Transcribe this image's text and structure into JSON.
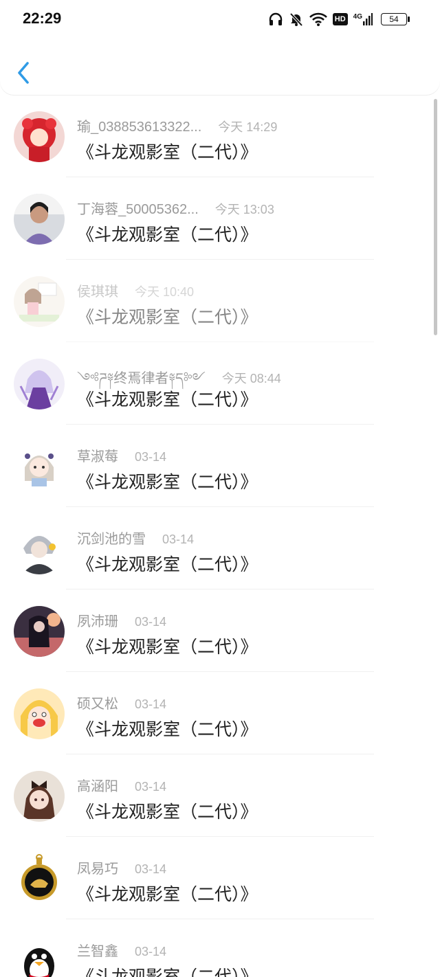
{
  "status_bar": {
    "time": "22:29",
    "battery": "54",
    "network_label": "4G",
    "hd_label": "HD"
  },
  "header": {
    "back_icon": "chevron-left-icon"
  },
  "colors": {
    "accent": "#2f9be6",
    "name_gray": "#9a9a9a",
    "time_gray": "#b3b3b3"
  },
  "messages": [
    {
      "name": "瑜_038853613322...",
      "time": "今天 14:29",
      "text": "《斗龙观影室（二代）》",
      "avatar": "red-costume-girl-avatar",
      "faded": false
    },
    {
      "name": "丁海蓉_50005362...",
      "time": "今天 13:03",
      "text": "《斗龙观影室（二代）》",
      "avatar": "woman-photo-avatar",
      "faded": false
    },
    {
      "name": "侯琪琪",
      "time": "今天 10:40",
      "text": "《斗龙观影室（二代）》",
      "avatar": "cartoon-girl-avatar",
      "faded": true
    },
    {
      "name": "༺ཌ༈终焉律者༈ད༻",
      "time": "今天 08:44",
      "text": "《斗龙观影室（二代）》",
      "avatar": "purple-anime-avatar",
      "faded": false
    },
    {
      "name": "草淑莓",
      "time": "03-14",
      "text": "《斗龙观影室（二代）》",
      "avatar": "chibi-girl-avatar",
      "faded": false
    },
    {
      "name": "沉剑池的雪",
      "time": "03-14",
      "text": "《斗龙观影室（二代）》",
      "avatar": "silver-hair-boy-avatar",
      "faded": false
    },
    {
      "name": "夙沛珊",
      "time": "03-14",
      "text": "《斗龙观影室（二代）》",
      "avatar": "dark-anime-avatar",
      "faded": false
    },
    {
      "name": "硕又松",
      "time": "03-14",
      "text": "《斗龙观影室（二代）》",
      "avatar": "blonde-cartoon-avatar",
      "faded": false
    },
    {
      "name": "高涵阳",
      "time": "03-14",
      "text": "《斗龙观影室（二代）》",
      "avatar": "bow-girl-avatar",
      "faded": false
    },
    {
      "name": "凤易巧",
      "time": "03-14",
      "text": "《斗龙观影室（二代）》",
      "avatar": "tiger-pendant-avatar",
      "faded": false
    },
    {
      "name": "兰智鑫",
      "time": "03-14",
      "text": "《斗龙观影室（二代）》",
      "avatar": "penguin-avatar",
      "faded": false
    }
  ]
}
